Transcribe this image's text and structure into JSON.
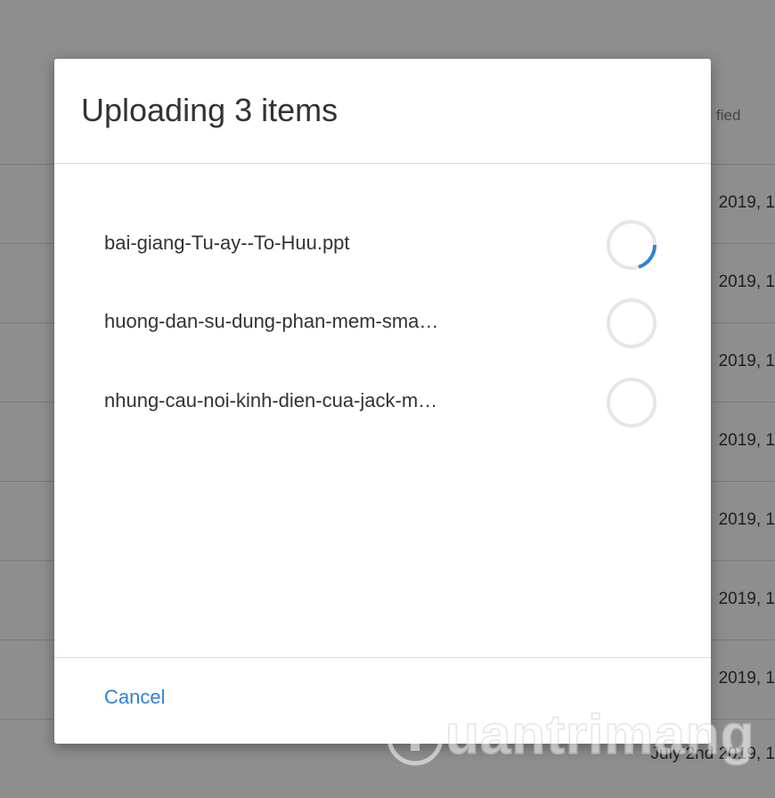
{
  "background": {
    "column_label": "fied",
    "rows": [
      {
        "date": "2019, 1"
      },
      {
        "date": "2019, 1"
      },
      {
        "date": "2019, 1"
      },
      {
        "date": "2019, 1"
      },
      {
        "date": "2019, 1"
      },
      {
        "date": "2019, 1"
      },
      {
        "date": "2019, 1"
      },
      {
        "date": "July 2nd 2019, 1"
      }
    ]
  },
  "dialog": {
    "title": "Uploading 3 items",
    "files": [
      {
        "name": "bai-giang-Tu-ay--To-Huu.ppt",
        "status": "uploading",
        "progress": 0.2
      },
      {
        "name": "huong-dan-su-dung-phan-mem-sma…",
        "status": "pending",
        "progress": 0
      },
      {
        "name": "nhung-cau-noi-kinh-dien-cua-jack-m…",
        "status": "pending",
        "progress": 0
      }
    ],
    "cancel_label": "Cancel"
  },
  "watermark": {
    "text": "uantrimang"
  },
  "colors": {
    "accent": "#2f82d6",
    "spinner_track": "#e6e6e6",
    "overlay": "#8e8e8e"
  }
}
